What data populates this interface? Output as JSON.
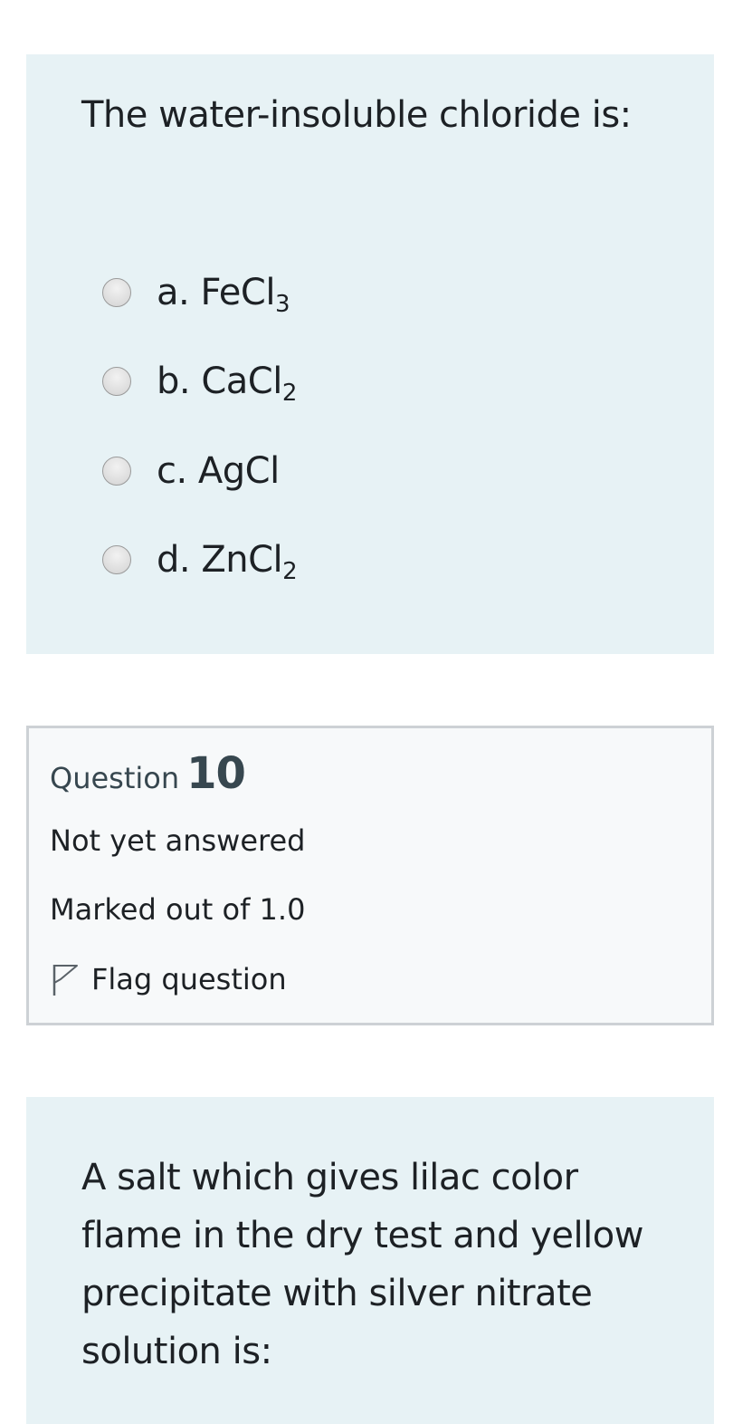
{
  "question9": {
    "text": "The water-insoluble chloride is:",
    "options": [
      {
        "prefix": "a. ",
        "base": "FeCl",
        "sub": "3"
      },
      {
        "prefix": "b. ",
        "base": "CaCl",
        "sub": "2"
      },
      {
        "prefix": "c. ",
        "base": "AgCl",
        "sub": ""
      },
      {
        "prefix": "d. ",
        "base": "ZnCl",
        "sub": "2"
      }
    ]
  },
  "question10_info": {
    "question_word": "Question",
    "question_number": "10",
    "state": "Not yet answered",
    "grade": "Marked out of 1.0",
    "flag_label": "Flag question",
    "flag_icon": "flag-outline-icon"
  },
  "question10": {
    "text": "A salt which gives lilac color flame in the dry test and yellow precipitate with silver nitrate solution is:"
  },
  "colors": {
    "formulation_bg": "#e7f2f5",
    "info_bg": "#f7f9fa",
    "info_border": "#cdd1d5",
    "text": "#1d2125",
    "heading": "#37474f"
  }
}
